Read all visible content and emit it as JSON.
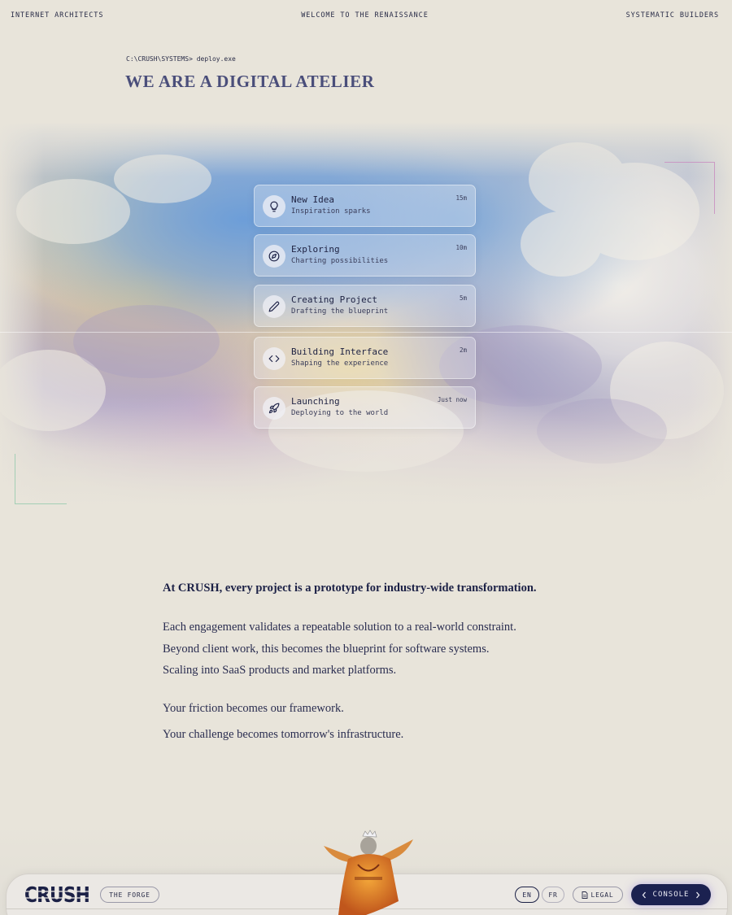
{
  "header": {
    "left": "INTERNET ARCHITECTS",
    "center": "WELCOME TO THE RENAISSANCE",
    "right": "SYSTEMATIC BUILDERS"
  },
  "hero": {
    "prompt": "C:\\CRUSH\\SYSTEMS> deploy.exe",
    "title": "WE ARE A DIGITAL ATELIER"
  },
  "timeline": [
    {
      "title": "New Idea",
      "subtitle": "Inspiration sparks",
      "time": "15m",
      "icon": "lightbulb-icon"
    },
    {
      "title": "Exploring",
      "subtitle": "Charting possibilities",
      "time": "10m",
      "icon": "compass-icon"
    },
    {
      "title": "Creating Project",
      "subtitle": "Drafting the blueprint",
      "time": "5m",
      "icon": "pencil-icon"
    },
    {
      "title": "Building Interface",
      "subtitle": "Shaping the experience",
      "time": "2m",
      "icon": "code-icon"
    },
    {
      "title": "Launching",
      "subtitle": "Deploying to the world",
      "time": "Just now",
      "icon": "rocket-icon"
    }
  ],
  "manifesto": {
    "lead": "At CRUSH, every project is a prototype for industry-wide transformation.",
    "lines": [
      "Each engagement validates a repeatable solution to a real-world constraint.",
      "Beyond client work, this becomes the blueprint for software systems.",
      "Scaling into SaaS products and market platforms."
    ],
    "closing": [
      "Your friction becomes our framework.",
      "Your challenge becomes tomorrow's infrastructure."
    ]
  },
  "footer": {
    "logo_text": "CRUSH",
    "forge_label": "THE FORGE",
    "lang_en": "EN",
    "lang_fr": "FR",
    "legal_label": "LEGAL",
    "console_label": "CONSOLE",
    "console_left_icon": "chevron-left-icon",
    "console_right_icon": "chevron-right-icon",
    "legal_icon": "document-icon",
    "mascot": "crowned-figure-mascot"
  },
  "colors": {
    "background": "#e8e4da",
    "navy": "#1c2146",
    "title_purple": "#4a4e7a",
    "console_bg": "#1b2150",
    "bracket_pink": "#c98bc0",
    "bracket_green": "#9ccdb2"
  }
}
